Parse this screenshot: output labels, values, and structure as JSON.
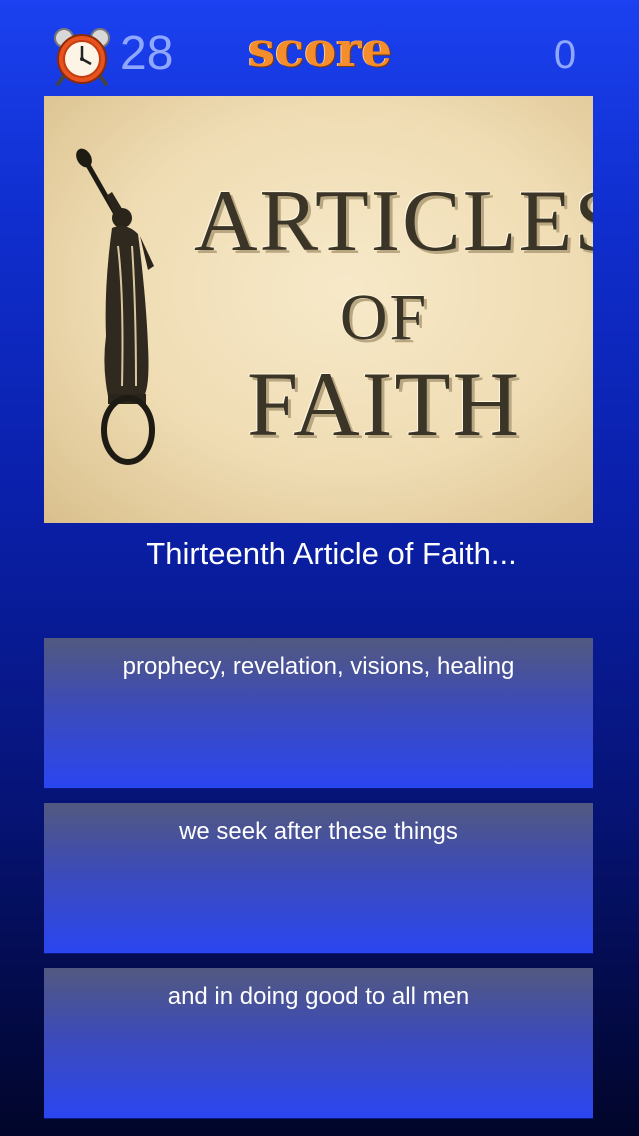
{
  "header": {
    "timer_icon": "alarm-clock-icon",
    "timer_value": "28",
    "title": "score",
    "score_value": "0"
  },
  "hero": {
    "line1": "ARTICLES",
    "line2": "OF",
    "line3": "FAITH"
  },
  "question": "Thirteenth Article of Faith...",
  "answers": [
    "prophecy, revelation, visions, healing",
    "we seek after these things",
    "and in doing good to all men"
  ],
  "colors": {
    "background_top": "#1b41f0",
    "background_bottom": "#01052a",
    "score_title": "#f58d2c",
    "counter_text": "#8fa7ff",
    "answer_button": "#2a46f0"
  }
}
